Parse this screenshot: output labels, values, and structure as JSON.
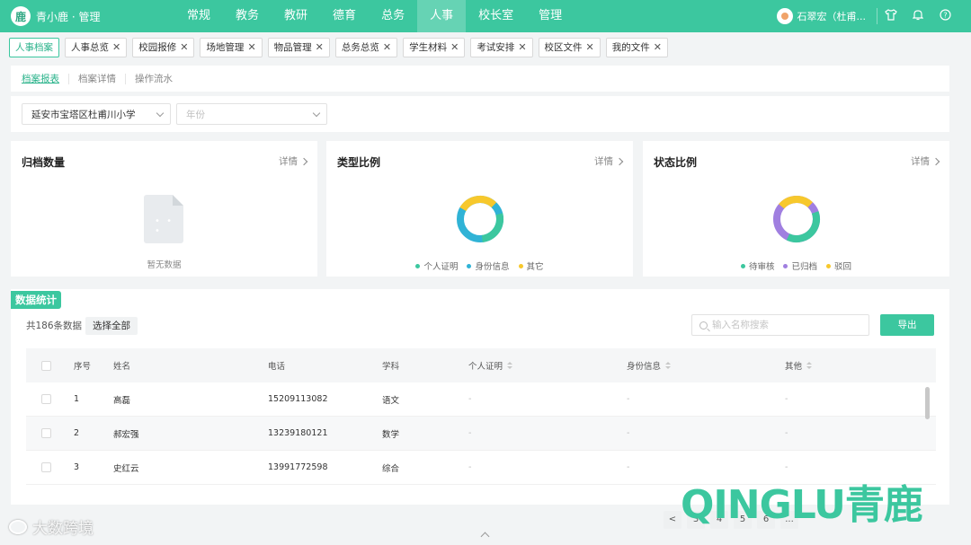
{
  "brand": {
    "logo_glyph": "鹿",
    "name": "青小鹿 · 管理"
  },
  "nav": [
    {
      "label": "常规"
    },
    {
      "label": "教务"
    },
    {
      "label": "教研"
    },
    {
      "label": "德育"
    },
    {
      "label": "总务"
    },
    {
      "label": "人事",
      "active": true
    },
    {
      "label": "校长室"
    },
    {
      "label": "管理"
    }
  ],
  "user": {
    "name": "石翠宏（杜甫..."
  },
  "top_icons": [
    "shirt-icon",
    "bell-icon",
    "help-icon"
  ],
  "tabs": [
    {
      "label": "人事档案",
      "active": true,
      "closable": false
    },
    {
      "label": "人事总览",
      "closable": true
    },
    {
      "label": "校园报修",
      "closable": true
    },
    {
      "label": "场地管理",
      "closable": true
    },
    {
      "label": "物品管理",
      "closable": true
    },
    {
      "label": "总务总览",
      "closable": true
    },
    {
      "label": "学生材料",
      "closable": true
    },
    {
      "label": "考试安排",
      "closable": true
    },
    {
      "label": "校区文件",
      "closable": true
    },
    {
      "label": "我的文件",
      "closable": true
    }
  ],
  "subtabs": [
    {
      "label": "档案报表",
      "active": true
    },
    {
      "label": "档案详情"
    },
    {
      "label": "操作流水"
    }
  ],
  "filters": {
    "school": "延安市宝塔区杜甫川小学",
    "year_placeholder": "年份"
  },
  "cards": {
    "archive_count": {
      "title": "归档数量",
      "link": "详情",
      "empty_text": "暂无数据"
    },
    "type_ratio": {
      "title": "类型比例",
      "link": "详情",
      "legend": [
        {
          "label": "个人证明",
          "color": "#3cc79f"
        },
        {
          "label": "身份信息",
          "color": "#30b3d6"
        },
        {
          "label": "其它",
          "color": "#f7c82c"
        }
      ]
    },
    "status_ratio": {
      "title": "状态比例",
      "link": "详情",
      "legend": [
        {
          "label": "待审核",
          "color": "#3cc79f"
        },
        {
          "label": "已归档",
          "color": "#a07fe0"
        },
        {
          "label": "驳回",
          "color": "#f7c82c"
        }
      ]
    }
  },
  "stats": {
    "title": "数据统计",
    "count_text": "共186条数据",
    "select_all": "选择全部",
    "search_placeholder": "输入名称搜索",
    "export": "导出",
    "columns": [
      "序号",
      "姓名",
      "电话",
      "学科",
      "个人证明",
      "身份信息",
      "其他"
    ],
    "rows": [
      {
        "no": "1",
        "name": "高磊",
        "phone": "15209113082",
        "subject": "语文",
        "personal": "-",
        "identity": "-",
        "other": "-"
      },
      {
        "no": "2",
        "name": "郝宏强",
        "phone": "13239180121",
        "subject": "数学",
        "personal": "-",
        "identity": "-",
        "other": "-"
      },
      {
        "no": "3",
        "name": "史红云",
        "phone": "13991772598",
        "subject": "综合",
        "personal": "-",
        "identity": "-",
        "other": "-"
      }
    ]
  },
  "pager": [
    "<",
    "3",
    "4",
    "5",
    "6",
    "..."
  ],
  "watermarks": {
    "left": "大数跨境",
    "right": "QINGLU青鹿"
  }
}
